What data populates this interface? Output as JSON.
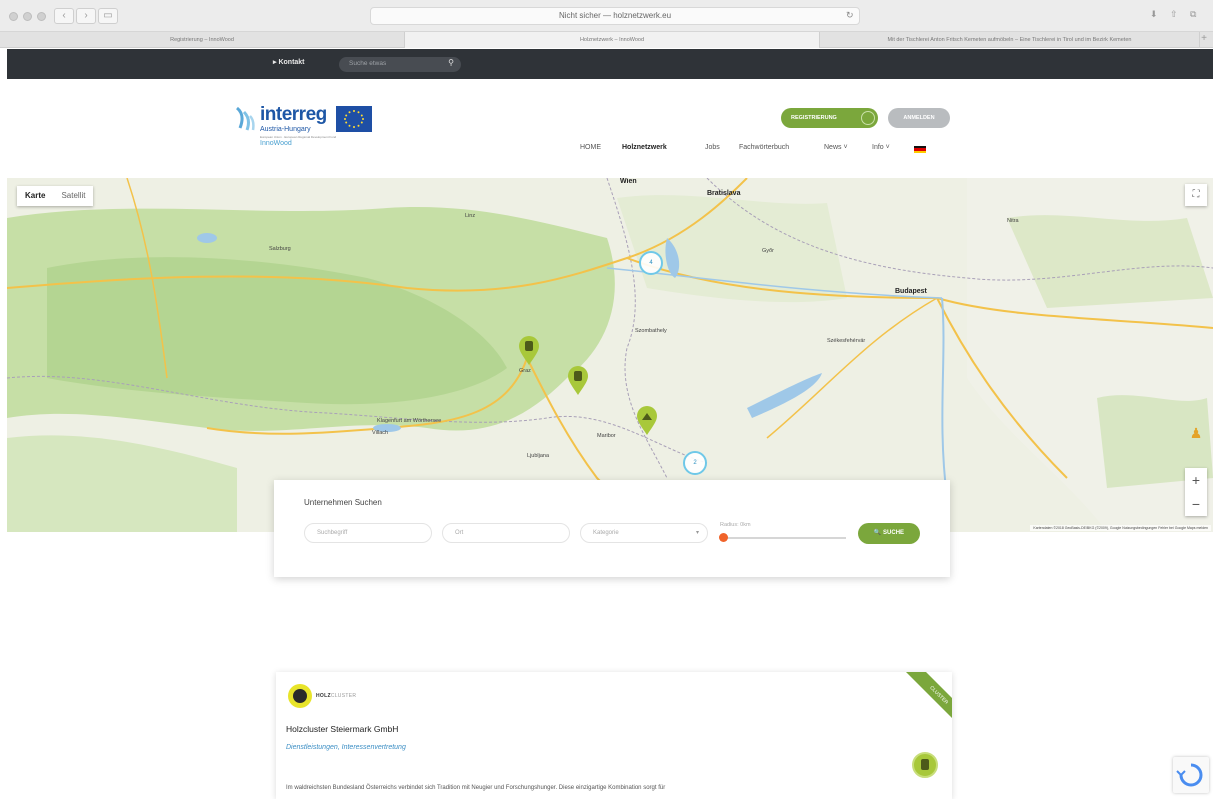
{
  "browser": {
    "url": "Nicht sicher — holznetzwerk.eu",
    "tabs": [
      "Registrierung – InnoWood",
      "Holznetzwerk – InnoWood",
      "Mit der Tischlerei Anton Fritsch Kemeten aufmöbeln – Eine Tischlerei in Tirol und im Bezirk Kemeten"
    ]
  },
  "topbar": {
    "kontakt": "▸ Kontakt",
    "search_placeholder": "Suche etwas"
  },
  "logo": {
    "brand": "interreg",
    "sub": "Austria-Hungary",
    "tiny": "European Union · European Regional Development Fund",
    "project": "InnoWood"
  },
  "header": {
    "register": "REGISTRIERUNG",
    "login": "ANMELDEN"
  },
  "nav": {
    "home": "HOME",
    "network": "Holznetzwerk",
    "jobs": "Jobs",
    "glossary": "Fachwörterbuch",
    "news": "News ˅",
    "info": "Info ˅"
  },
  "map": {
    "type_map": "Karte",
    "type_sat": "Satellit",
    "attribution": "Kartendaten ©2018 GeoBasis-DE/BKG (©2009), Google   Nutzungsbedingungen   Fehler bei Google Maps melden",
    "cities": {
      "wien": "Wien",
      "bratislava": "Bratislava",
      "budapest": "Budapest",
      "salzburg": "Salzburg",
      "klagenfurt": "Klagenfurt am Wörthersee",
      "graz": "Graz",
      "gyor": "Győr",
      "szekes": "Székesfehérvár",
      "nitra": "Nitra",
      "linz": "Linz",
      "villach": "Villach",
      "maribor": "Maribor",
      "ljubljana": "Ljubljana",
      "szombathely": "Szombathely"
    },
    "clusters": [
      "4",
      "2"
    ]
  },
  "search": {
    "title": "Unternehmen Suchen",
    "keyword_placeholder": "Suchbegriff",
    "location_placeholder": "Ort",
    "category_placeholder": "Kategorie",
    "radius_label": "Radius: 0km",
    "button": "🔍  SUCHE"
  },
  "card": {
    "logo_text": "HOLZ",
    "logo_text2": "CLUSTER",
    "name": "Holzcluster Steiermark GmbH",
    "categories": "Dienstleistungen, Interessenvertretung",
    "badge": "CLUSTER",
    "description": "Im waldreichsten Bundesland Österreichs verbindet sich Tradition mit Neugier und Forschungshunger. Diese einzigartige Kombination sorgt für"
  }
}
